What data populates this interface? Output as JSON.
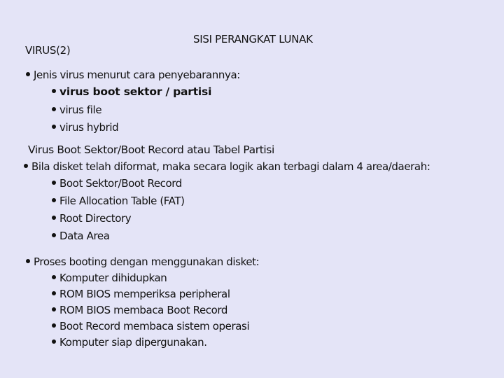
{
  "header": {
    "title": "SISI PERANGKAT LUNAK",
    "page_title": "VIRUS(2)"
  },
  "section1": {
    "intro": "Jenis virus menurut cara penyebarannya:",
    "items": [
      "virus boot sektor / partisi",
      "virus file",
      "virus hybrid"
    ]
  },
  "section2": {
    "heading": "Virus Boot Sektor/Boot Record atau Tabel Partisi",
    "intro": "Bila disket telah diformat, maka secara logik akan terbagi dalam 4 area/daerah:",
    "items": [
      "Boot Sektor/Boot Record",
      "File Allocation Table (FAT)",
      "Root Directory",
      "Data Area"
    ]
  },
  "section3": {
    "intro": "Proses booting dengan menggunakan disket:",
    "items": [
      "Komputer dihidupkan",
      "ROM BIOS memperiksa peripheral",
      "ROM BIOS membaca Boot Record",
      "Boot Record membaca sistem operasi",
      "Komputer siap dipergunakan."
    ]
  }
}
